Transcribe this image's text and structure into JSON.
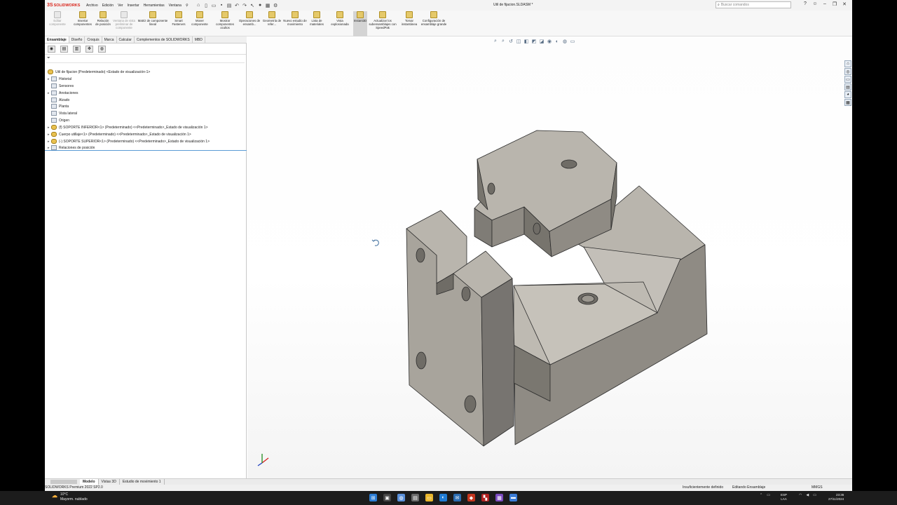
{
  "app": {
    "logo_ds": "3S",
    "logo_name": "SOLIDWORKS",
    "document_title": "Util de fijacion.SLDASM *"
  },
  "menu": [
    "Archivo",
    "Edición",
    "Ver",
    "Insertar",
    "Herramientas",
    "Ventana"
  ],
  "search": {
    "placeholder": "Buscar comandos"
  },
  "ribbon": [
    {
      "label": "Editar componente",
      "enabled": false
    },
    {
      "label": "Insertar componentes",
      "enabled": true
    },
    {
      "label": "Relación de posición",
      "enabled": true
    },
    {
      "label": "Ventana de vista preliminar de componente",
      "enabled": false
    },
    {
      "label": "Matriz de componente lineal",
      "enabled": true
    },
    {
      "label": "Smart Fasteners",
      "enabled": true
    },
    {
      "label": "Mover componente",
      "enabled": true
    },
    {
      "label": "Mostrar componentes ocultos",
      "enabled": true
    },
    {
      "label": "Operaciones de ensamb...",
      "enabled": true
    },
    {
      "label": "Geometría de refer...",
      "enabled": true
    },
    {
      "label": "Nuevo estudio de movimiento",
      "enabled": true
    },
    {
      "label": "Lista de materiales",
      "enabled": true
    },
    {
      "label": "Vista explosionada",
      "enabled": true
    },
    {
      "label": "Instant3D",
      "enabled": true,
      "active": true
    },
    {
      "label": "Actualizar los subensamblajes con SpeedPak",
      "enabled": true
    },
    {
      "label": "Tomar instantánea",
      "enabled": true
    },
    {
      "label": "Configuración de ensamblaje grande",
      "enabled": true
    }
  ],
  "cm_tabs": [
    "Ensamblaje",
    "Diseño",
    "Croquis",
    "Marca",
    "Calcular",
    "Complementos de SOLIDWORKS",
    "MBD"
  ],
  "tree": {
    "root": "Util de fijacion (Predeterminado) <Estado de visualización-1>",
    "items": [
      {
        "label": "Historial",
        "expand": "▸"
      },
      {
        "label": "Sensores",
        "expand": ""
      },
      {
        "label": "Anotaciones",
        "expand": "▸"
      },
      {
        "label": "Alzado",
        "expand": ""
      },
      {
        "label": "Planta",
        "expand": ""
      },
      {
        "label": "Vista lateral",
        "expand": ""
      },
      {
        "label": "Origen",
        "expand": ""
      },
      {
        "label": "(f) SOPORTE INFERIOR<1> (Predeterminado) <<Predeterminado>_Estado de visualización 1>",
        "expand": "▸"
      },
      {
        "label": "Cuerpo utillaje<1> (Predeterminado) <<Predeterminado>_Estado de visualización 1>",
        "expand": "▸"
      },
      {
        "label": "(-) SOPORTE SUPERIOR<1> (Predeterminado) <<Predeterminado>_Estado de visualización 1>",
        "expand": "▸"
      },
      {
        "label": "Relaciones de posición",
        "expand": "▸"
      }
    ]
  },
  "bottom_tabs": [
    "Modelo",
    "Vistas 3D",
    "Estudio de movimiento 1"
  ],
  "status": {
    "version": "SOLIDWORKS Premium 2022 SP2.0",
    "definition": "Insuficientemente definido",
    "mode": "Editando Ensamblaje",
    "units": "MMGS"
  },
  "taskbar": {
    "temperature": "10°C",
    "weather": "Mayorm. nublado",
    "lang1": "ESP",
    "lang2": "LAA",
    "time": "23:36",
    "date": "27/11/2024"
  },
  "colors": {
    "part_top": "#b9b5ad",
    "part_side": "#8f8b84",
    "part_dark": "#6f6c66",
    "brand_red": "#d9261c"
  }
}
